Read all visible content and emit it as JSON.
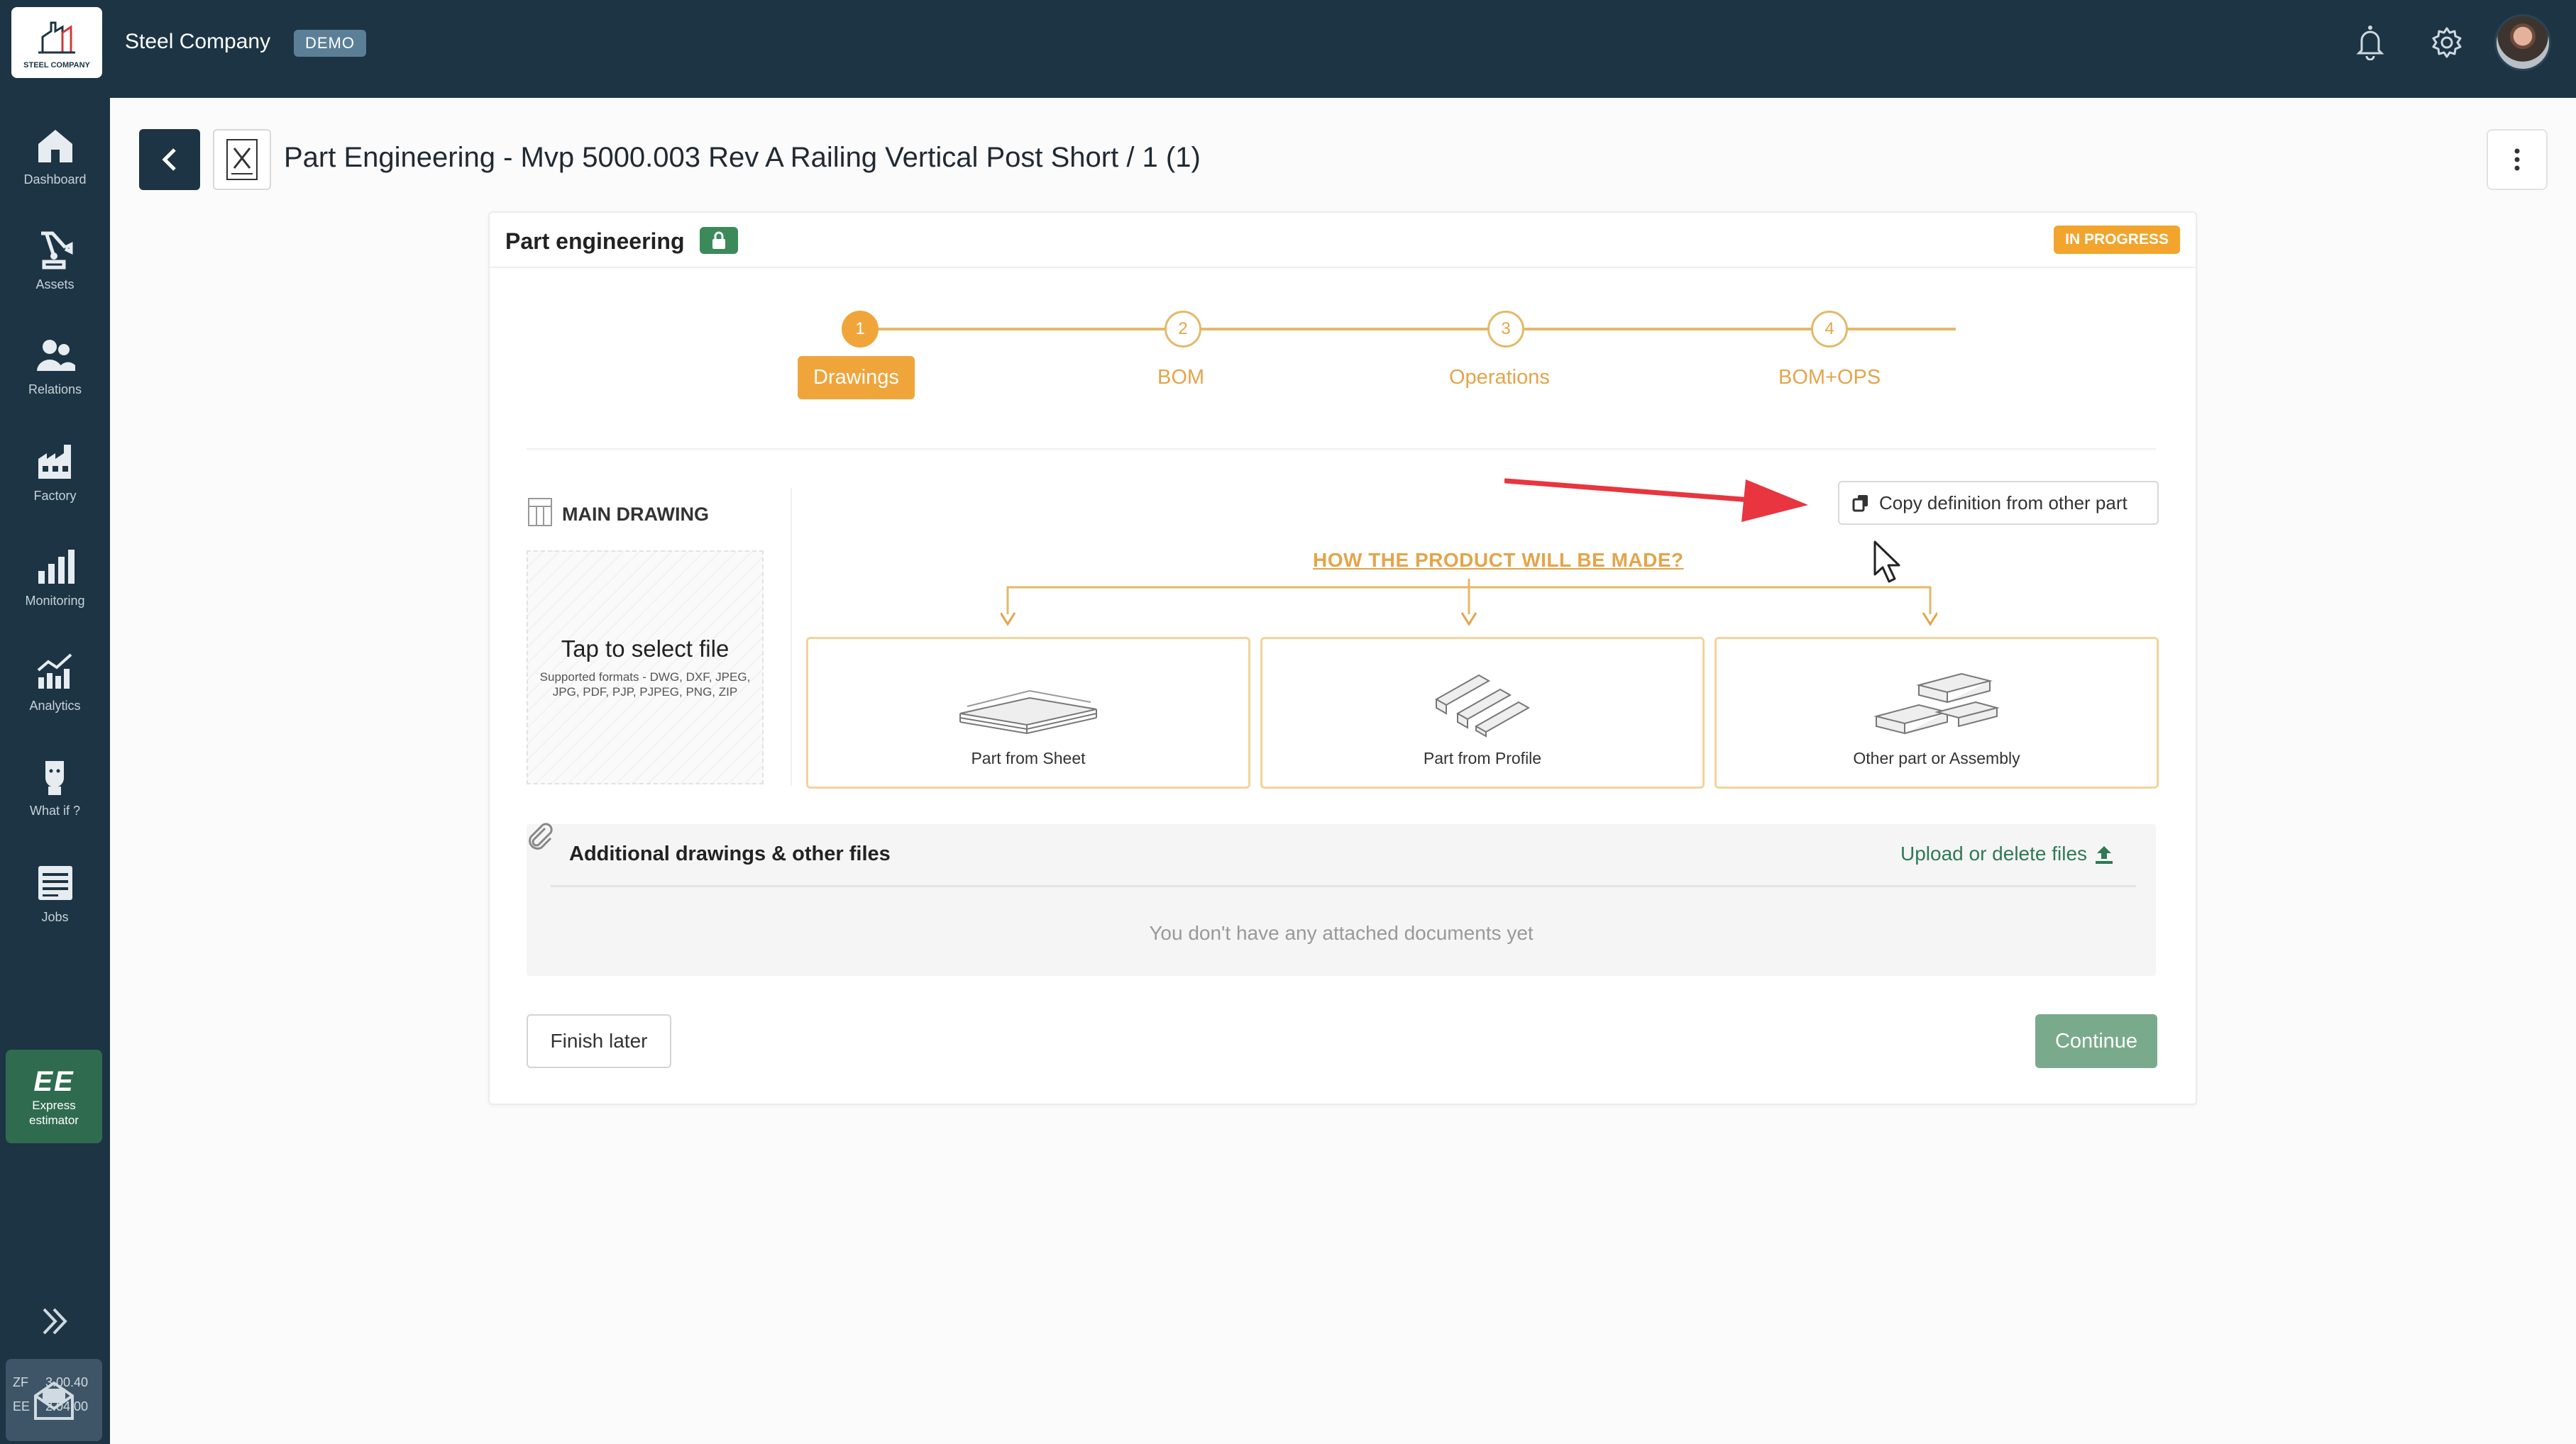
{
  "header": {
    "logo_text": "STEEL COMPANY",
    "company": "Steel Company",
    "badge": "DEMO",
    "icons": [
      "bell-icon",
      "gear-icon",
      "avatar"
    ]
  },
  "sidebar": {
    "items": [
      {
        "label": "Dashboard",
        "icon": "home-icon"
      },
      {
        "label": "Assets",
        "icon": "robot-arm-icon"
      },
      {
        "label": "Relations",
        "icon": "people-icon"
      },
      {
        "label": "Factory",
        "icon": "factory-icon"
      },
      {
        "label": "Monitoring",
        "icon": "bar-chart-icon"
      },
      {
        "label": "Analytics",
        "icon": "analytics-icon"
      },
      {
        "label": "What if ?",
        "icon": "thinking-person-icon"
      },
      {
        "label": "Jobs",
        "icon": "jobs-icon"
      }
    ],
    "express": {
      "logo": "EE",
      "label_1": "Express",
      "label_2": "estimator"
    },
    "versions": [
      {
        "name": "ZF",
        "value": "3.00.40"
      },
      {
        "name": "EE",
        "value": "2.04.00"
      }
    ]
  },
  "page": {
    "title": "Part Engineering - Mvp 5000.003 Rev A Railing Vertical Post Short / 1 (1)"
  },
  "card": {
    "title": "Part engineering",
    "status": "IN PROGRESS",
    "status_color": "#f2a42c",
    "accent_color": "#f0a53b",
    "steps": [
      {
        "number": "1",
        "label": "Drawings",
        "active": true
      },
      {
        "number": "2",
        "label": "BOM",
        "active": false
      },
      {
        "number": "3",
        "label": "Operations",
        "active": false
      },
      {
        "number": "4",
        "label": "BOM+OPS",
        "active": false
      }
    ],
    "main_drawing": {
      "label": "MAIN DRAWING",
      "dropzone_title": "Tap to select file",
      "dropzone_sub": "Supported formats - DWG, DXF, JPEG, JPG, PDF, PJP, PJPEG, PNG, ZIP"
    },
    "copy_button": "Copy definition from other part",
    "how_link": "HOW THE PRODUCT WILL BE MADE?",
    "options": [
      {
        "label": "Part from Sheet",
        "icon": "sheet-stack-icon"
      },
      {
        "label": "Part from Profile",
        "icon": "profile-beams-icon"
      },
      {
        "label": "Other part or Assembly",
        "icon": "assembly-icon"
      }
    ],
    "attachments": {
      "title": "Additional drawings & other files",
      "upload_link": "Upload or delete files",
      "empty": "You don't have any attached documents yet"
    },
    "finish_button": "Finish later",
    "continue_button": "Continue",
    "continue_color": "#7aaa8c"
  }
}
